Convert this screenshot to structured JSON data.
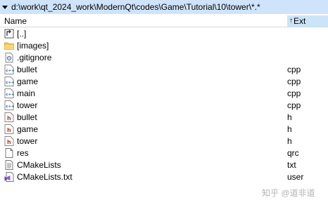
{
  "path": "d:\\work\\qt_2024_work\\ModernQt\\codes\\Game\\Tutorial\\10\\tower\\*.*",
  "columns": {
    "name": "Name",
    "ext": "Ext",
    "sort_indicator": "↑"
  },
  "rows": [
    {
      "name": "[..]",
      "ext": "",
      "icon": "up-folder-icon"
    },
    {
      "name": "[images]",
      "ext": "",
      "icon": "folder-icon"
    },
    {
      "name": ".gitignore",
      "ext": "",
      "icon": "gear-file-icon"
    },
    {
      "name": "bullet",
      "ext": "cpp",
      "icon": "cpp-file-icon"
    },
    {
      "name": "game",
      "ext": "cpp",
      "icon": "cpp-file-icon"
    },
    {
      "name": "main",
      "ext": "cpp",
      "icon": "cpp-file-icon"
    },
    {
      "name": "tower",
      "ext": "cpp",
      "icon": "cpp-file-icon"
    },
    {
      "name": "bullet",
      "ext": "h",
      "icon": "h-file-icon"
    },
    {
      "name": "game",
      "ext": "h",
      "icon": "h-file-icon"
    },
    {
      "name": "tower",
      "ext": "h",
      "icon": "h-file-icon"
    },
    {
      "name": "res",
      "ext": "qrc",
      "icon": "blank-file-icon"
    },
    {
      "name": "CMakeLists",
      "ext": "txt",
      "icon": "text-file-icon"
    },
    {
      "name": "CMakeLists.txt",
      "ext": "user",
      "icon": "vs-file-icon"
    }
  ],
  "watermark": "知乎 @道非道"
}
